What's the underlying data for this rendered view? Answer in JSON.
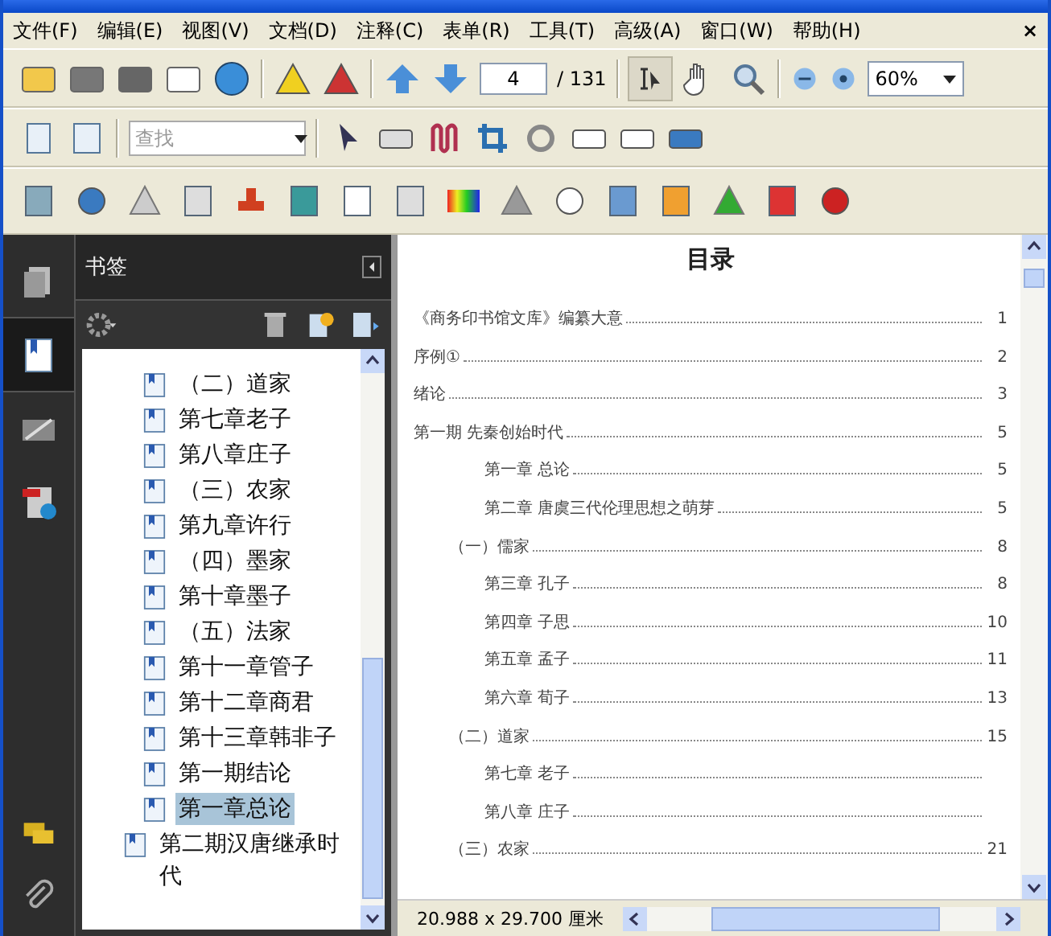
{
  "menu": {
    "items": [
      "文件(F)",
      "编辑(E)",
      "视图(V)",
      "文档(D)",
      "注释(C)",
      "表单(R)",
      "工具(T)",
      "高级(A)",
      "窗口(W)",
      "帮助(H)"
    ],
    "close": "×"
  },
  "toolbar": {
    "page_number": "4",
    "page_total": "/ 131",
    "zoom": "60%",
    "find_placeholder": "查找"
  },
  "side_tabs": [
    {
      "kind": "pages",
      "selected": false
    },
    {
      "kind": "bookmarks",
      "selected": true
    },
    {
      "kind": "signatures",
      "selected": false
    },
    {
      "kind": "info",
      "selected": false
    }
  ],
  "bookmarks": {
    "title": "书签",
    "nested_items": [
      {
        "label": "（二）道家",
        "selected": false
      },
      {
        "label": "第七章老子",
        "selected": false
      },
      {
        "label": "第八章庄子",
        "selected": false
      },
      {
        "label": "（三）农家",
        "selected": false
      },
      {
        "label": "第九章许行",
        "selected": false
      },
      {
        "label": "（四）墨家",
        "selected": false
      },
      {
        "label": "第十章墨子",
        "selected": false
      },
      {
        "label": "（五）法家",
        "selected": false
      },
      {
        "label": "第十一章管子",
        "selected": false
      },
      {
        "label": "第十二章商君",
        "selected": false
      },
      {
        "label": "第十三章韩非子",
        "selected": false
      },
      {
        "label": "第一期结论",
        "selected": false
      },
      {
        "label": "第一章总论",
        "selected": true
      }
    ],
    "items": [
      {
        "label": "第二期汉唐继承时代",
        "selected": false
      }
    ]
  },
  "document": {
    "title": "目录",
    "entries": [
      {
        "kind": "part",
        "text": "《商务印书馆文库》编纂大意",
        "page": "1"
      },
      {
        "kind": "part",
        "text": "序例①",
        "page": "2"
      },
      {
        "kind": "part",
        "text": "绪论",
        "page": "3"
      },
      {
        "kind": "part",
        "text": "第一期 先秦创始时代",
        "page": "5"
      },
      {
        "kind": "chapter",
        "text": "第一章  总论",
        "page": "5"
      },
      {
        "kind": "chapter",
        "text": "第二章  唐虞三代伦理思想之萌芽",
        "page": "5"
      },
      {
        "kind": "section",
        "text": "（一）儒家",
        "page": "8"
      },
      {
        "kind": "chapter",
        "text": "第三章  孔子",
        "page": "8"
      },
      {
        "kind": "chapter",
        "text": "第四章  子思",
        "page": "10"
      },
      {
        "kind": "chapter",
        "text": "第五章  孟子",
        "page": "11"
      },
      {
        "kind": "chapter",
        "text": "第六章  荀子",
        "page": "13"
      },
      {
        "kind": "section",
        "text": "（二）道家",
        "page": "15"
      },
      {
        "kind": "chapter",
        "text": "第七章  老子"
      },
      {
        "kind": "chapter",
        "text": "第八章  庄子"
      },
      {
        "kind": "section",
        "text": "（三）农家",
        "page": "21"
      }
    ]
  },
  "status_bar": {
    "page_size": "20.988 x 29.700 厘米"
  }
}
